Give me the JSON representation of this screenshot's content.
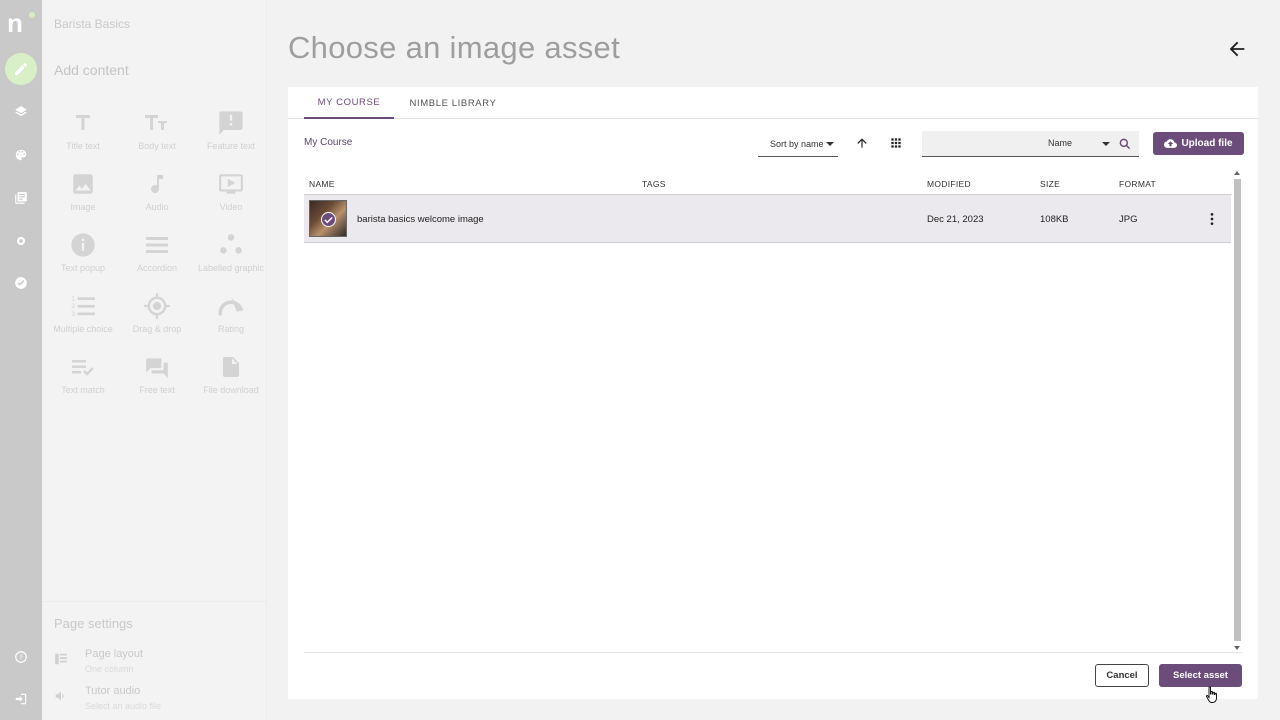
{
  "app": {
    "logo": "n",
    "course_title": "Barista Basics"
  },
  "sidebar": {
    "add_content_title": "Add content",
    "tools": [
      {
        "label": "Title text",
        "icon": "title-text-icon"
      },
      {
        "label": "Body text",
        "icon": "body-text-icon"
      },
      {
        "label": "Feature text",
        "icon": "feature-text-icon"
      },
      {
        "label": "Image",
        "icon": "image-icon"
      },
      {
        "label": "Audio",
        "icon": "audio-icon"
      },
      {
        "label": "Video",
        "icon": "video-icon"
      },
      {
        "label": "Text popup",
        "icon": "info-icon"
      },
      {
        "label": "Accordion",
        "icon": "accordion-icon"
      },
      {
        "label": "Labelled graphic",
        "icon": "labelled-graphic-icon"
      },
      {
        "label": "Multiple choice",
        "icon": "numbered-list-icon"
      },
      {
        "label": "Drag & drop",
        "icon": "target-icon"
      },
      {
        "label": "Rating",
        "icon": "rating-icon"
      },
      {
        "label": "Text match",
        "icon": "text-match-icon"
      },
      {
        "label": "Free text",
        "icon": "free-text-icon"
      },
      {
        "label": "File download",
        "icon": "file-icon"
      }
    ],
    "page_settings_title": "Page settings",
    "page_layout": {
      "title": "Page layout",
      "subtitle": "One column"
    },
    "tutor_audio": {
      "title": "Tutor audio",
      "subtitle": "Select an audio file"
    }
  },
  "dialog": {
    "title": "Choose an image asset",
    "tabs": [
      {
        "label": "MY COURSE"
      },
      {
        "label": "NIMBLE LIBRARY"
      }
    ],
    "breadcrumb": "My Course",
    "sort_label": "Sort by name",
    "search": {
      "value": "",
      "field": "Name"
    },
    "upload_label": "Upload file",
    "columns": {
      "name": "NAME",
      "tags": "TAGS",
      "modified": "MODIFIED",
      "size": "SIZE",
      "format": "FORMAT"
    },
    "rows": [
      {
        "name": "barista basics welcome image",
        "tags": "",
        "modified": "Dec 21, 2023",
        "size": "108KB",
        "format": "JPG"
      }
    ],
    "cancel_label": "Cancel",
    "select_label": "Select asset"
  },
  "colors": {
    "accent": "#6b4c7a",
    "rail": "#c9c9c9",
    "active_rail": "#d9efc8"
  }
}
